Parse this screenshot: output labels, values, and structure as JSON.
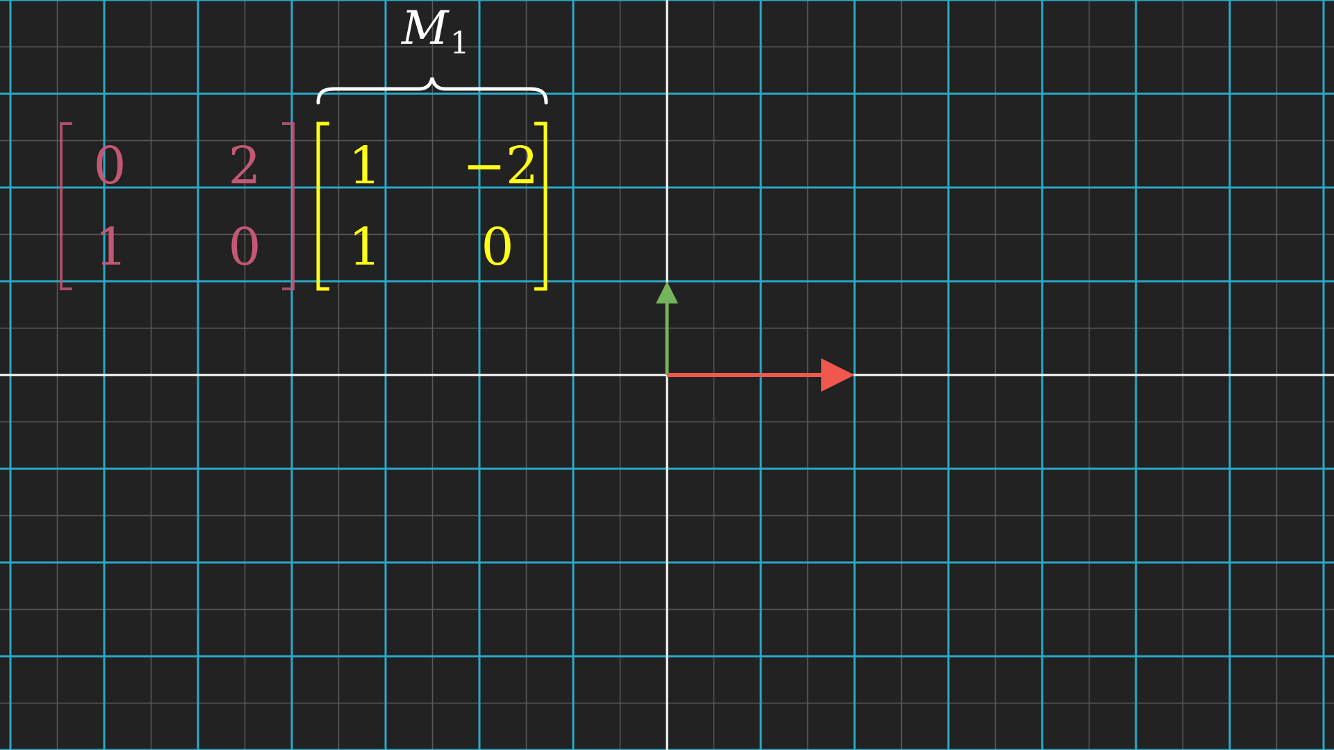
{
  "colors": {
    "background": "#222222",
    "major_grid": "#29a9c8",
    "minor_grid": "#5a5a5a",
    "axis": "#ffffff",
    "left_matrix": "#c25874",
    "right_matrix": "#ffff18",
    "i_hat_vector": "#f0584e",
    "j_hat_vector": "#74b45a",
    "brace": "#ffffff"
  },
  "label": {
    "letter": "M",
    "subscript": "1"
  },
  "left_matrix": {
    "r1c1": "0",
    "r1c2": "2",
    "r2c1": "1",
    "r2c2": "0"
  },
  "right_matrix": {
    "r1c1": "1",
    "r1c2": "−2",
    "r2c1": "1",
    "r2c2": "0"
  },
  "vectors": {
    "i_hat": [
      1,
      0
    ],
    "j_hat": [
      0,
      0.5
    ]
  }
}
